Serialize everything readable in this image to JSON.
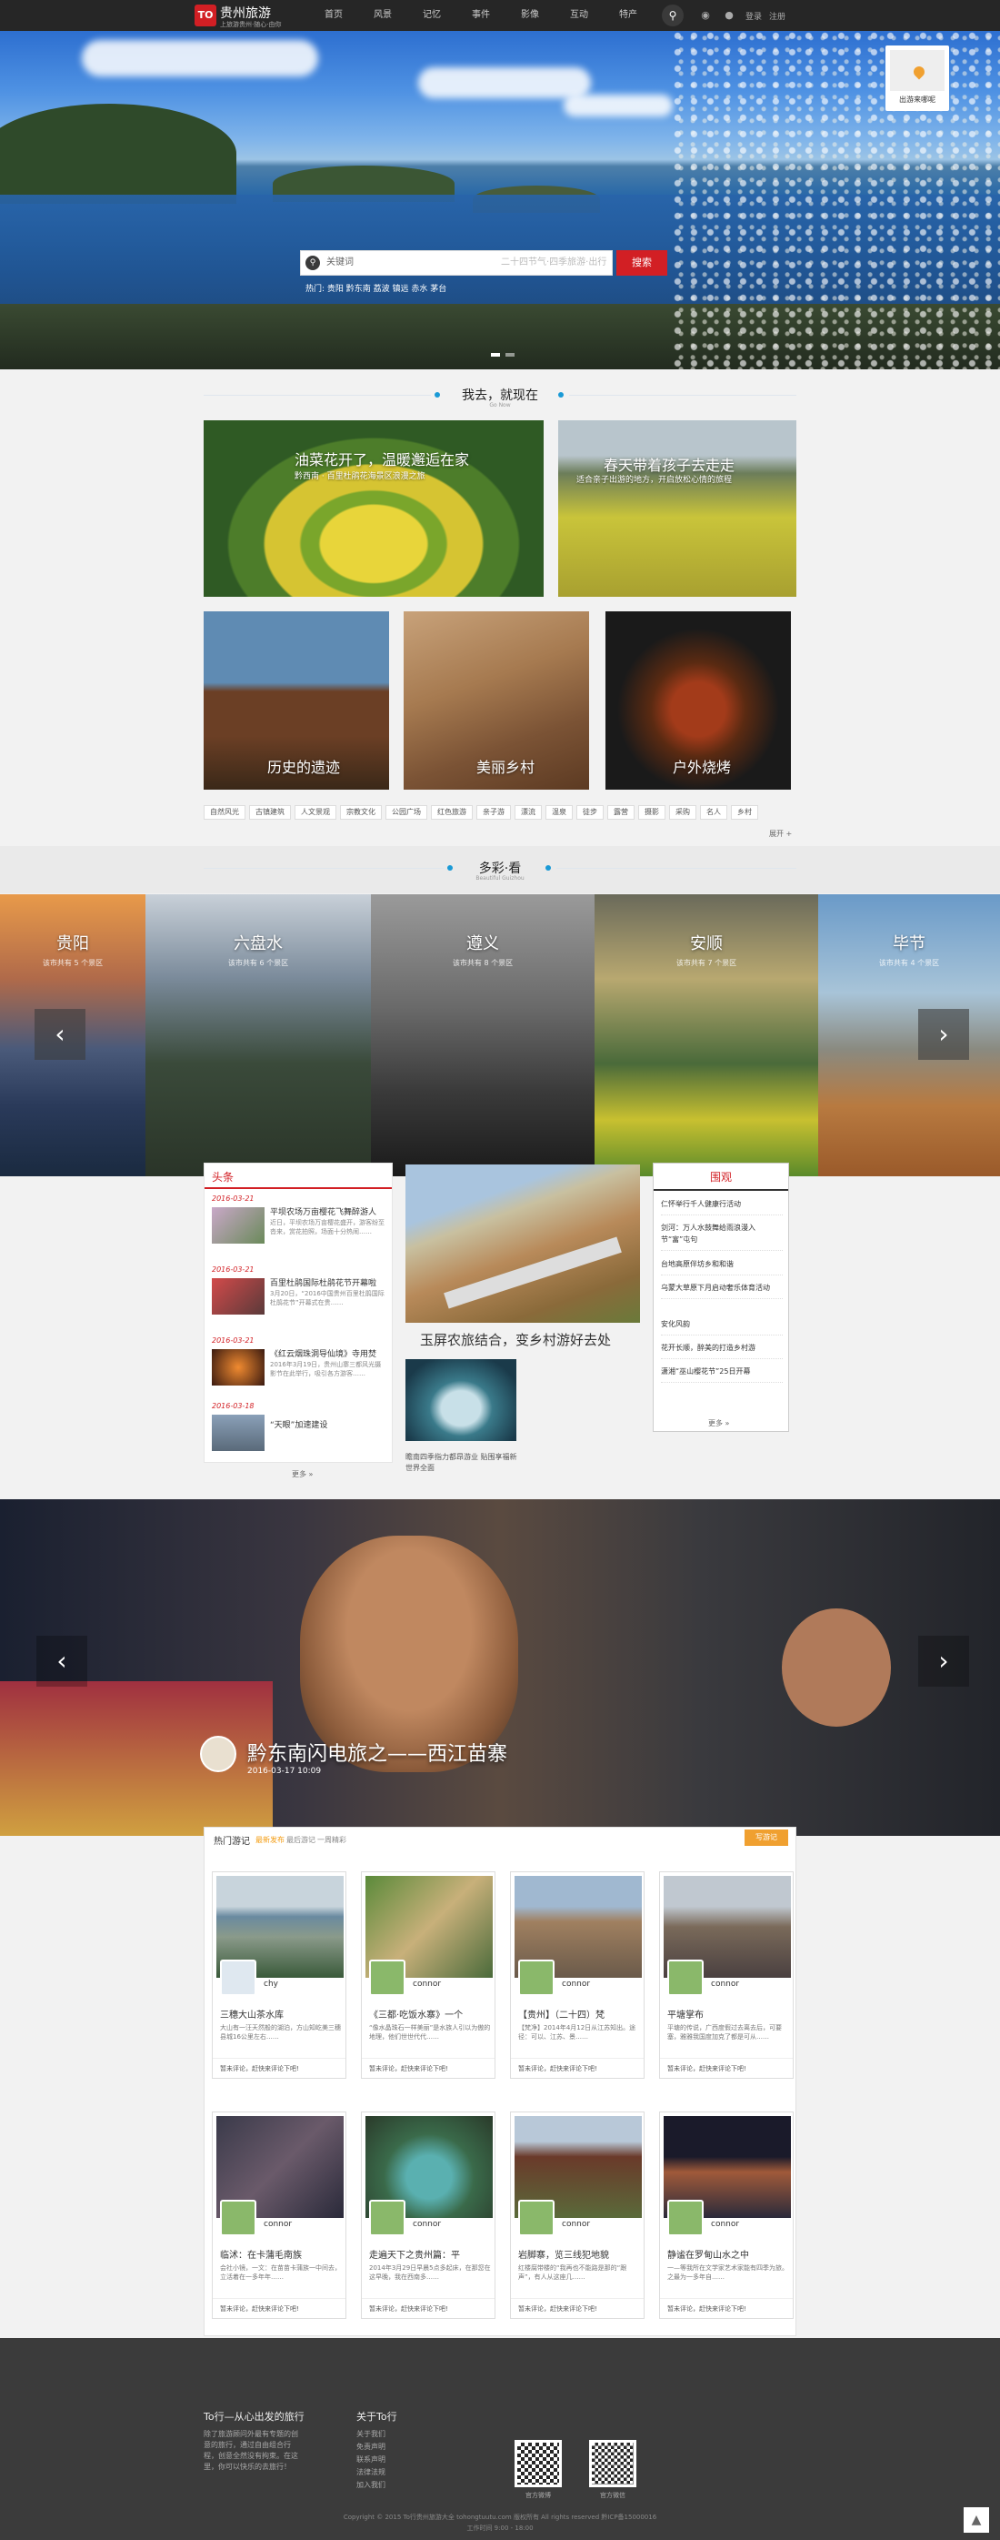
{
  "header": {
    "logo_mark": "TO",
    "logo_title": "贵州旅游",
    "logo_sub": "上旅游贵州·随心·由你",
    "nav": [
      "首页",
      "风景",
      "记忆",
      "事件",
      "影像",
      "互动",
      "特产"
    ],
    "login": "登录",
    "register": "注册"
  },
  "hero": {
    "search_placeholder": "关键词",
    "search_hint": "二十四节气·四季旅游·出行",
    "search_button": "搜索",
    "hot_words": "热门: 贵阳 黔东南 荔波 镇远 赤水 茅台",
    "qr_card_label": "出游来哪呢"
  },
  "section1": {
    "title": "我去，就现在",
    "subtitle": "Go Now"
  },
  "cards": [
    {
      "cap": "油菜花开了，温暖邂逅在家",
      "sub": "黔西南 · 百里杜鹃花海景区浪漫之旅"
    },
    {
      "cap": "春天带着孩子去走走",
      "sub": "适合亲子出游的地方，开启放松心情的旅程"
    },
    {
      "cap": "历史的遗迹"
    },
    {
      "cap": "美丽乡村"
    },
    {
      "cap": "户外烧烤"
    }
  ],
  "tags": [
    "自然风光",
    "古镇建筑",
    "人文景观",
    "宗教文化",
    "公园广场",
    "红色旅游",
    "亲子游",
    "漂流",
    "温泉",
    "徒步",
    "露营",
    "摄影",
    "采购",
    "名人",
    "乡村"
  ],
  "tags_more": "展开 +",
  "section2": {
    "title": "多彩·看",
    "subtitle": "Beautiful Guizhou"
  },
  "cities": [
    {
      "name": "贵阳",
      "desc": "该市共有 5 个景区"
    },
    {
      "name": "六盘水",
      "desc": "该市共有 6 个景区"
    },
    {
      "name": "遵义",
      "desc": "该市共有 8 个景区"
    },
    {
      "name": "安顺",
      "desc": "该市共有 7 个景区"
    },
    {
      "name": "毕节",
      "desc": "该市共有 4 个景区"
    }
  ],
  "news": {
    "head": "头条",
    "items": [
      {
        "date": "2016-03-21",
        "title": "平坝农场万亩樱花飞舞醉游人",
        "text": "近日，平坝农场万亩樱花盛开，游客纷至沓来，赏花拍照，场面十分热闹……"
      },
      {
        "date": "2016-03-21",
        "title": "百里杜鹃国际杜鹃花节开幕啦",
        "text": "3月20日，“2016中国贵州百里杜鹃国际杜鹃花节”开幕式在贵……"
      },
      {
        "date": "2016-03-21",
        "title": "《红云烟珠洞导仙境》寺用焚",
        "text": "2016年3月19日，贵州山寨三都风光摄影节在此举行，吸引各方游客……"
      },
      {
        "date": "2016-03-18",
        "title": "“天眼”加速建设",
        "text": ""
      }
    ],
    "more": "更多 »"
  },
  "feature": {
    "title": "玉屏农旅结合，变乡村游好去处",
    "text2": "瞻南四季指力都昂游业 贴围享福新世界全面"
  },
  "poll": {
    "head": "围观",
    "items": [
      "仁怀举行千人健康行活动",
      "剑河：万人水鼓舞给雨浪漫入节“富”屯句",
      "台地高原伴坊乡和和谐",
      "乌蒙大草原下月启动奢乐体育活动",
      "安化风韵",
      "花开长顺，醉美的打造乡村游",
      "潇湘“巫山樱花节”25日开幕"
    ],
    "more": "更多 »"
  },
  "banner2": {
    "caption": "黔东南闪电旅之——西江苗寨",
    "date": "2016-03-17 10:09"
  },
  "travel": {
    "title": "热门游记",
    "tabs": [
      "最新发布",
      "最后游记",
      "一周精彩"
    ],
    "button": "写游记",
    "cards": [
      {
        "user": "chy",
        "title": "三穗大山茶水库",
        "excerpt": "大山有一汪天然般的湖泊，方山知屹美三穗县城16公里左右……",
        "foot": "暂未评论，赶快来评论下吧!"
      },
      {
        "user": "connor",
        "title": "《三都·吃饭水寨》一个",
        "excerpt": "“像水晶珠石一样美丽”是水族人引以为傲的地理，他们世世代代……",
        "foot": "暂未评论，赶快来评论下吧!"
      },
      {
        "user": "connor",
        "title": "【贵州】（二十四）梵",
        "excerpt": "【梵净】2014年4月12日从江苏知出。途径：可以、江苏、景……",
        "foot": "暂未评论，赶快来评论下吧!"
      },
      {
        "user": "connor",
        "title": "平塘掌布",
        "excerpt": "平塘的传说，广西度假过去离去后，可要塞，雅雅我国度加克了都是可从……",
        "foot": "暂未评论，赶快来评论下吧!"
      },
      {
        "user": "connor",
        "title": "临沭：在卡蒲毛南族",
        "excerpt": "会社小镜，一文：在苗苗卡蒲族一中间去，立活着在一多年年……",
        "foot": "暂未评论，赶快来评论下吧!"
      },
      {
        "user": "connor",
        "title": "走遍天下之贵州篇：平",
        "excerpt": "2014年3月29日早晨5点多起床，在那您在这早晚，我在西南多……",
        "foot": "暂未评论，赶快来评论下吧!"
      },
      {
        "user": "connor",
        "title": "岩脚寨，览三线犯地貌",
        "excerpt": "红楼腐带楼的“我再也不能路是那的“跟声”，有人从这座几……",
        "foot": "暂未评论，赶快来评论下吧!"
      },
      {
        "user": "connor",
        "title": "静谧在罗甸山水之中",
        "excerpt": "一—等我所在文学家艺术家能有四季为旅。之最为一多年自……",
        "foot": "暂未评论，赶快来评论下吧!"
      }
    ]
  },
  "footer": {
    "col1_head": "To行—从心出发的旅行",
    "col1_text": "除了旅游顾问外最有专题的创意的旅行，通过自由组合行程，创意全然没有拘束。在这里，你可以快乐的去旅行！",
    "col2_head": "关于To行",
    "col2_links": [
      "关于我们",
      "免责声明",
      "联系声明",
      "法律法规",
      "加入我们"
    ],
    "qr1_label": "官方微博",
    "qr2_label": "官方微信",
    "copyright": "Copyright © 2015 To行贵州旅游大全 tohongtuutu.com 版权所有 All rights reserved 黔ICP备15000016",
    "hours": "工作时间 9:00 - 18:00"
  },
  "colors": {
    "accent": "#d21f24",
    "topbar": "#262626",
    "footer": "#3b3b3b",
    "orange": "#f0a030",
    "title_dot": "#1a9ad6"
  }
}
